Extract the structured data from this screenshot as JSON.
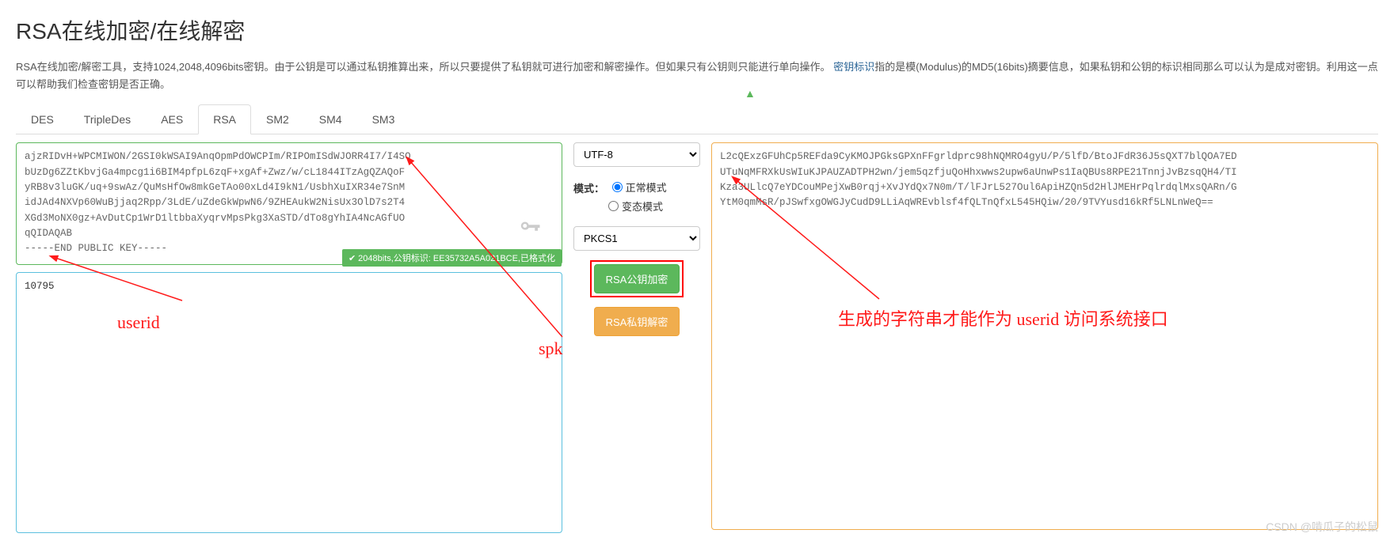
{
  "header": {
    "title": "RSA在线加密/在线解密",
    "desc_1": "RSA在线加密/解密工具，支持1024,2048,4096bits密钥。由于公钥是可以通过私钥推算出来，所以只要提供了私钥就可进行加密和解密操作。但如果只有公钥则只能进行单向操作。",
    "link_label": "密钥标识",
    "desc_2": "指的是模(Modulus)的MD5(16bits)摘要信息，如果私钥和公钥的标识相同那么可以认为是成对密钥。利用这一点可以帮助我们检查密钥是否正确。"
  },
  "tabs": [
    "DES",
    "TripleDes",
    "AES",
    "RSA",
    "SM2",
    "SM4",
    "SM3"
  ],
  "active_tab": "RSA",
  "key_text": "ajzRIDvH+WPCMIWON/2GSI0kWSAI9AnqOpmPdOWCPIm/RIPOmISdWJORR4I7/I4SO\nbUzDg6ZZtKbvjGa4mpcg1i6BIM4pfpL6zqF+xgAf+Zwz/w/cL1844ITzAgQZAQoF\nyRB8v3luGK/uq+9swAz/QuMsHfOw8mkGeTAo00xLd4I9kN1/UsbhXuIXR34e7SnM\nidJAd4NXVp60WuBjjaq2Rpp/3LdE/uZdeGkWpwN6/9ZHEAukW2NisUx3OlD7s2T4\nXGd3MoNX0gz+AvDutCp1WrD1ltbbaXyqrvMpsPkg3XaSTD/dTo8gYhIA4NcAGfUO\nqQIDAQAB\n-----END PUBLIC KEY-----",
  "badge": "2048bits,公钥标识: EE35732A5A021BCE,已格式化",
  "input_text": "10795",
  "encoding": {
    "options": [
      "UTF-8"
    ],
    "selected": "UTF-8"
  },
  "mode": {
    "label": "模式：",
    "normal": "正常模式",
    "variant": "变态模式",
    "selected": "normal"
  },
  "padding": {
    "options": [
      "PKCS1"
    ],
    "selected": "PKCS1"
  },
  "buttons": {
    "encrypt": "RSA公钥加密",
    "decrypt": "RSA私钥解密"
  },
  "output_text": "L2cQExzGFUhCp5REFda9CyKMOJPGksGPXnFFgrldprc98hNQMRO4gyU/P/5lfD/BtoJFdR36J5sQXT7blQOA7ED\nUTuNqMFRXkUsWIuKJPAUZADTPH2wn/jem5qzfjuQoHhxwws2upw6aUnwPs1IaQBUs8RPE21TnnjJvBzsqQH4/TI\nKza3ULlcQ7eYDCouMPejXwB0rqj+XvJYdQx7N0m/T/lFJrL527Oul6ApiHZQn5d2HlJMEHrPqlrdqlMxsQARn/G\nYtM0qmMsR/pJSwfxgOWGJyCudD9LLiAqWREvblsf4fQLTnQfxL545HQiw/20/9TVYusd16kRf5LNLnWeQ==",
  "annotations": {
    "userid": "userid",
    "spk": "spk",
    "result": "生成的字符串才能作为 userid 访问系统接口"
  },
  "watermark": "CSDN @啃瓜子的松鼠"
}
